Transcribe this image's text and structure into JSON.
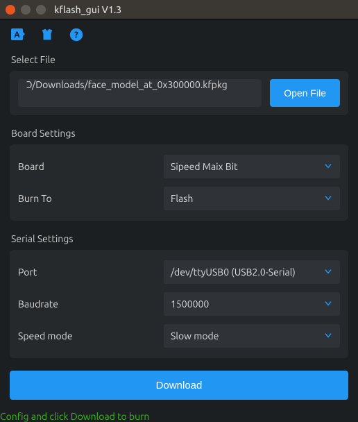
{
  "window": {
    "title": "kflash_gui V1.3"
  },
  "toolbar": {
    "icon1": "language-icon",
    "icon2": "pin-icon",
    "icon3": "help-icon"
  },
  "file": {
    "section_label": "Select File",
    "path": "ɔ/Downloads/face_model_at_0x300000.kfpkg",
    "open_label": "Open File"
  },
  "board": {
    "section_label": "Board Settings",
    "rows": [
      {
        "label": "Board",
        "value": "Sipeed Maix Bit"
      },
      {
        "label": "Burn To",
        "value": "Flash"
      }
    ]
  },
  "serial": {
    "section_label": "Serial Settings",
    "rows": [
      {
        "label": "Port",
        "value": "/dev/ttyUSB0 (USB2.0-Serial)"
      },
      {
        "label": "Baudrate",
        "value": "1500000"
      },
      {
        "label": "Speed mode",
        "value": "Slow mode"
      }
    ]
  },
  "download_label": "Download",
  "status_text": "Config and click Download to burn"
}
